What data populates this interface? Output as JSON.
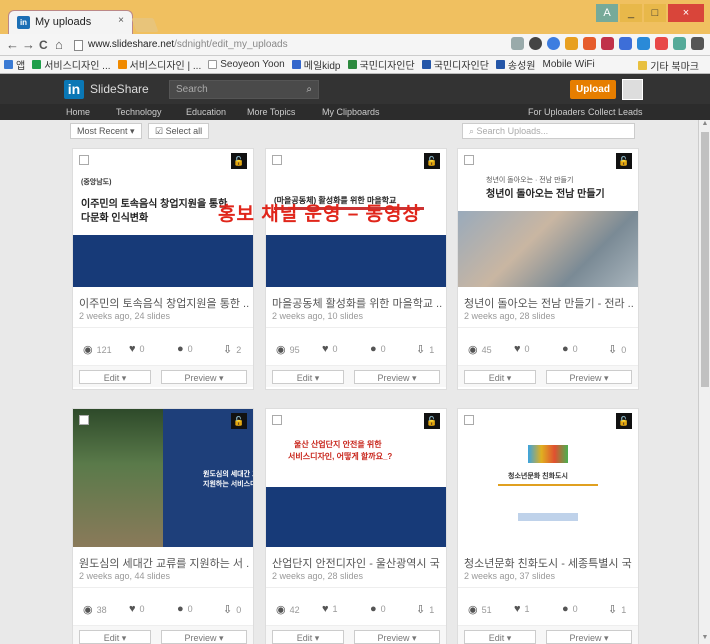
{
  "browser": {
    "tab_title": "My uploads",
    "tab_close": "×",
    "url_host": "www.slideshare.net",
    "url_path": "/sdnight/edit_my_uploads",
    "window_buttons": [
      "A",
      "_",
      "□",
      "×"
    ],
    "nav": {
      "back": "←",
      "forward": "→",
      "reload": "C",
      "home": "⌂"
    },
    "bookmarks": [
      {
        "label": "앱",
        "color": "#3b7bd4"
      },
      {
        "label": "서비스디자인 ...",
        "color": "#1e9e4a"
      },
      {
        "label": "서비스디자인 | ...",
        "color": "#f08a00"
      },
      {
        "label": "Seoyeon Yoon",
        "color": "#ffffff"
      },
      {
        "label": "메일kidp",
        "color": "#3366cc"
      },
      {
        "label": "국민디자인단",
        "color": "#2d8a3e"
      },
      {
        "label": "국민디자인단",
        "color": "#2456a8"
      },
      {
        "label": "송성원",
        "color": "#2456a8"
      }
    ],
    "bookmark_wifi": "Mobile WiFi",
    "bookmark_other": "기타 북마크"
  },
  "slideshare": {
    "logo_letter": "in",
    "logo_text": "SlideShare",
    "search_placeholder": "Search",
    "search_icon": "magnifier-icon",
    "upload_label": "Upload",
    "nav": [
      "Home",
      "Technology",
      "Education",
      "More Topics",
      "My Clipboards"
    ],
    "nav_right": [
      "For Uploaders",
      "Collect Leads"
    ]
  },
  "filter": {
    "sort_label": "Most Recent ▾",
    "select_all_label": "Select all",
    "search_placeholder": "Search Uploads..."
  },
  "overlay_text": "홍보 채널 운영 – 동영상",
  "cards": [
    {
      "title": "이주민의 토속음식 창업지원을 통한 ...",
      "meta": "2 weeks ago, 24 slides",
      "views": "121",
      "likes": "0",
      "comments": "0",
      "downloads": "2",
      "slide_heading": "이주민의 토속음식 창업지원을 통한",
      "slide_sub": "다문화 인식변화",
      "slide_tag": "(중앙남도)"
    },
    {
      "title": "마을공동체 활성화를 위한 마을학교 ...",
      "meta": "2 weeks ago, 10 slides",
      "views": "95",
      "likes": "0",
      "comments": "0",
      "downloads": "1",
      "slide_heading": "(마을공동체) 활성화를 위한 마을학교",
      "slide_sub": ""
    },
    {
      "title": "청년이 돌아오는 전남 만들기 - 전라 ...",
      "meta": "2 weeks ago, 28 slides",
      "views": "45",
      "likes": "0",
      "comments": "0",
      "downloads": "0",
      "slide_heading": "청년이 돌아오는 전남 만들기",
      "slide_sub": "청년이 돌아오는 · 전남 만들기"
    },
    {
      "title": "원도심의 세대간 교류를 지원하는 서 ...",
      "meta": "2 weeks ago, 44 slides",
      "views": "38",
      "likes": "0",
      "comments": "0",
      "downloads": "0",
      "slide_heading": "원도심의 세대간 교류",
      "slide_sub": "지원하는 서비스디자"
    },
    {
      "title": "산업단지 안전디자인 - 울산광역시 국 ...",
      "meta": "2 weeks ago, 28 slides",
      "views": "42",
      "likes": "1",
      "comments": "0",
      "downloads": "1",
      "slide_heading": "울산 산업단지 안전을 위한",
      "slide_sub": "서비스디자인, 어떻게 할까요_?"
    },
    {
      "title": "청소년문화 친화도시 - 세종특별시 국 ...",
      "meta": "2 weeks ago, 37 slides",
      "views": "51",
      "likes": "1",
      "comments": "0",
      "downloads": "1",
      "slide_heading": "청소년문화 친화도시",
      "slide_sub": ""
    }
  ],
  "card_actions": {
    "edit": "Edit ▾",
    "preview": "Preview ▾"
  },
  "icons": {
    "views": "eye-icon",
    "likes": "heart-icon",
    "comments": "comment-icon",
    "downloads": "download-icon",
    "lock": "lock-icon"
  },
  "colors": {
    "upload": "#e67e00",
    "slide_navy": "#173a78",
    "overlay": "#e0261b",
    "chrome": "#f0c060"
  }
}
